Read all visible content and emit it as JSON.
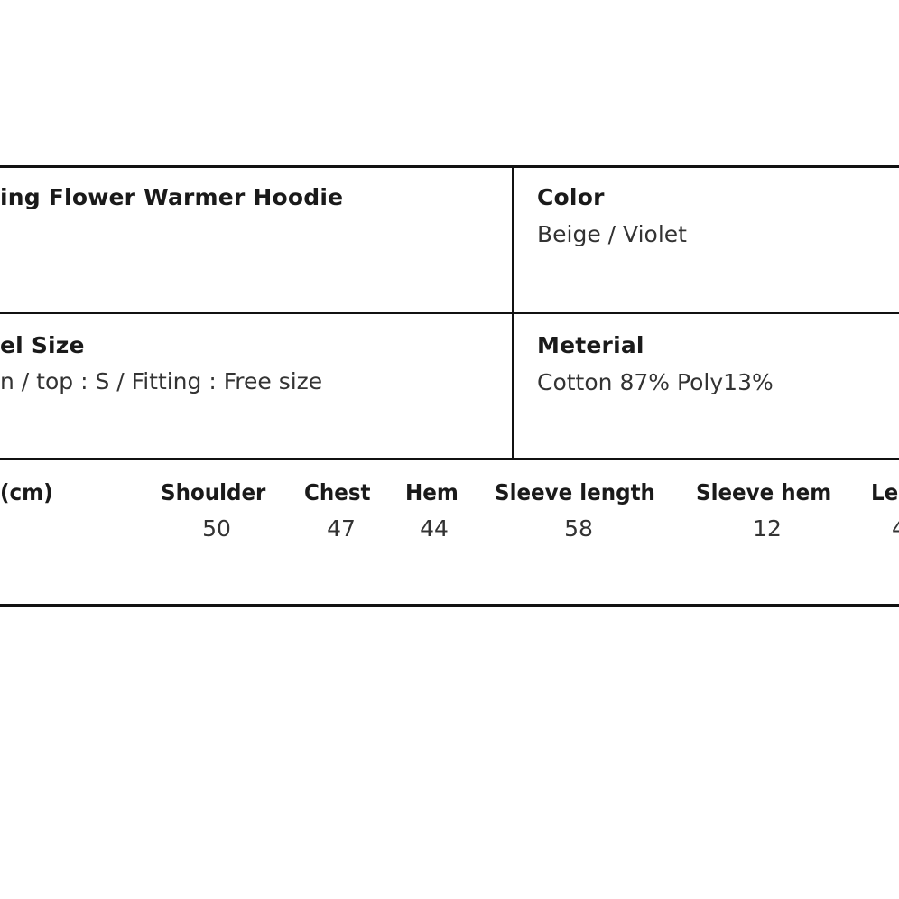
{
  "product": {
    "name_label": "ing Flower Warmer Hoodie",
    "color_label": "Color",
    "color_value": "Beige / Violet",
    "model_size_label": "el Size",
    "model_size_value": "n / top : S / Fitting : Free size",
    "material_label": "Meterial",
    "material_value": "Cotton 87% Poly13%"
  },
  "size_table": {
    "unit_label": "(cm)",
    "headers": [
      "Shoulder",
      "Chest",
      "Hem",
      "Sleeve length",
      "Sleeve hem",
      "Le"
    ],
    "values": [
      "50",
      "47",
      "44",
      "58",
      "12",
      "4"
    ]
  }
}
